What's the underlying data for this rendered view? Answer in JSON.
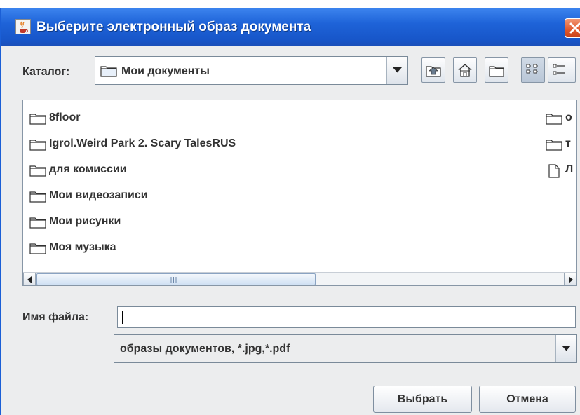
{
  "window": {
    "title": "Выберите электронный образ документа",
    "app_icon": "java-coffee-icon",
    "close_icon": "close-icon"
  },
  "lookin": {
    "label": "Каталог:",
    "value": "Мои документы"
  },
  "toolbar": {
    "buttons": [
      "up-one-level-icon",
      "home-icon",
      "new-folder-icon",
      "list-view-icon",
      "details-view-icon"
    ]
  },
  "file_list": {
    "column1": [
      {
        "name": "8floor",
        "type": "folder"
      },
      {
        "name": "Igrol.Weird Park 2. Scary TalesRUS",
        "type": "folder"
      },
      {
        "name": "для комиссии",
        "type": "folder"
      },
      {
        "name": "Мои видеозаписи",
        "type": "folder"
      },
      {
        "name": "Мои рисунки",
        "type": "folder"
      },
      {
        "name": "Моя музыка",
        "type": "folder"
      }
    ],
    "column2": [
      {
        "name": "о",
        "type": "folder"
      },
      {
        "name": "т",
        "type": "folder"
      },
      {
        "name": "Л",
        "type": "file"
      }
    ]
  },
  "filename": {
    "label": "Имя файла:",
    "value": ""
  },
  "filter": {
    "value": "образы документов, *.jpg,*.pdf"
  },
  "buttons": {
    "select": "Выбрать",
    "cancel": "Отмена"
  },
  "colors": {
    "titlebar": "#1e63d8",
    "close_button": "#e0582c",
    "dialog_background": "#ecedee"
  }
}
